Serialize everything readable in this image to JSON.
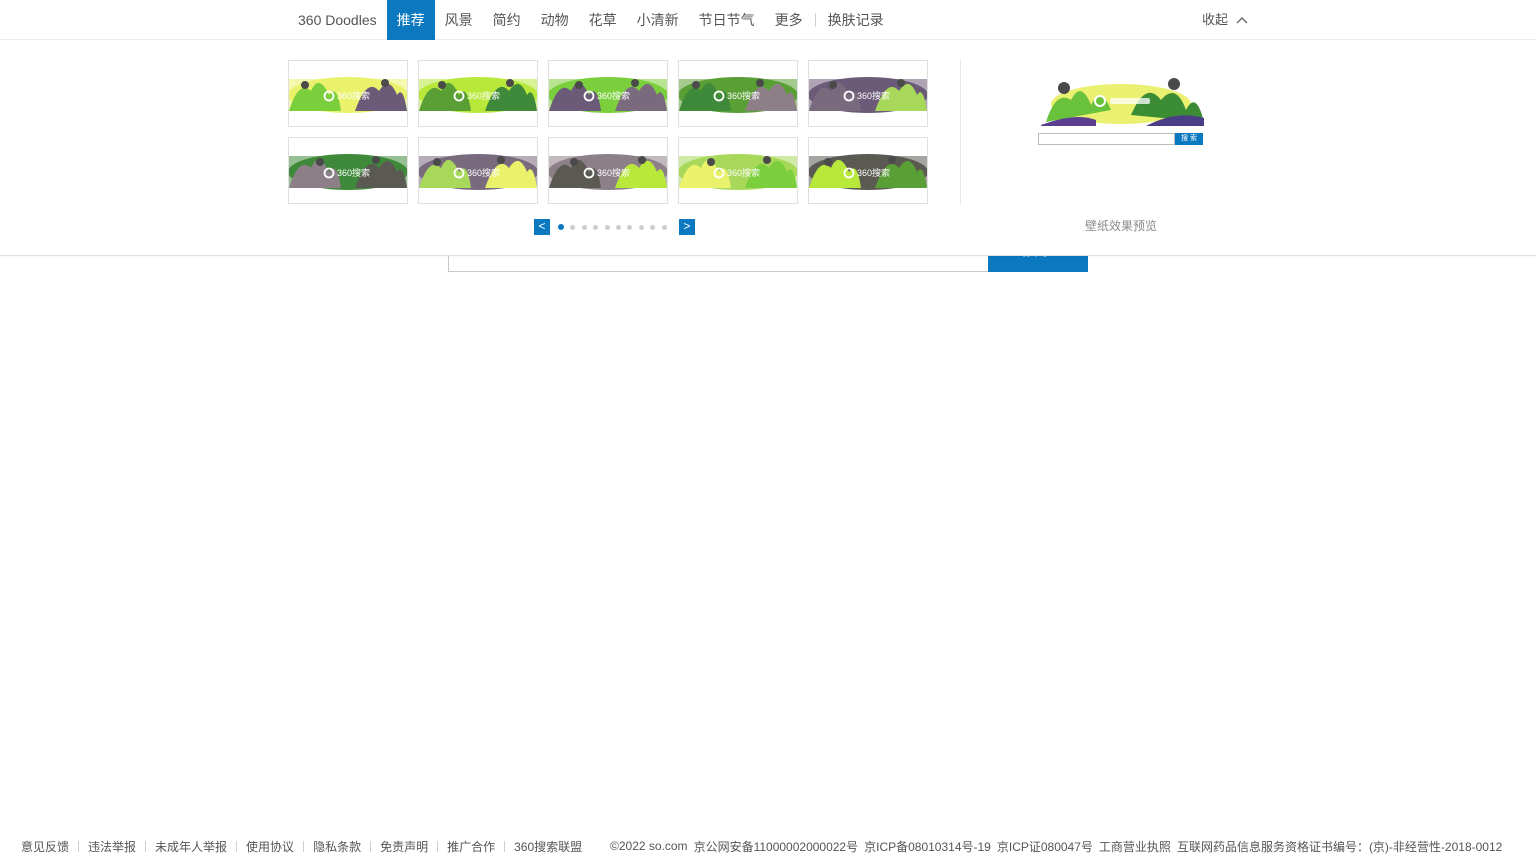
{
  "tabs": {
    "items": [
      "360 Doodles",
      "推荐",
      "风景",
      "简约",
      "动物",
      "花草",
      "小清新",
      "节日节气",
      "更多"
    ],
    "active_index": 1,
    "history": "换肤记录"
  },
  "collapse_label": "收起",
  "thumbnails": {
    "logo_text": "360搜索",
    "count": 10
  },
  "pager": {
    "prev": "<",
    "next": ">",
    "page_count": 10,
    "current_page": 1
  },
  "preview": {
    "search_button": "搜 索",
    "label": "壁纸效果预览"
  },
  "main_search": {
    "button_label": "搜索"
  },
  "footer": {
    "links": [
      "意见反馈",
      "违法举报",
      "未成年人举报",
      "使用协议",
      "隐私条款",
      "免责声明",
      "推广合作",
      "360搜索联盟"
    ],
    "copyright": "©2022 so.com",
    "icp1": "京公网安备11000002000022号",
    "icp2": "京ICP备08010314号-19",
    "icp3": "京ICP证080047号",
    "license": "工商营业执照",
    "drug": "互联网药品信息服务资格证书编号：(京)-非经营性-2018-0012"
  },
  "colors": {
    "accent": "#0b78c0",
    "thumb_palette": [
      "#e9f26a",
      "#b7e83a",
      "#7bcf3c",
      "#5a9f35",
      "#6b5a78",
      "#3f8a3a",
      "#7a6a7e",
      "#8d7f88",
      "#a7d85a",
      "#5a5a52"
    ]
  }
}
